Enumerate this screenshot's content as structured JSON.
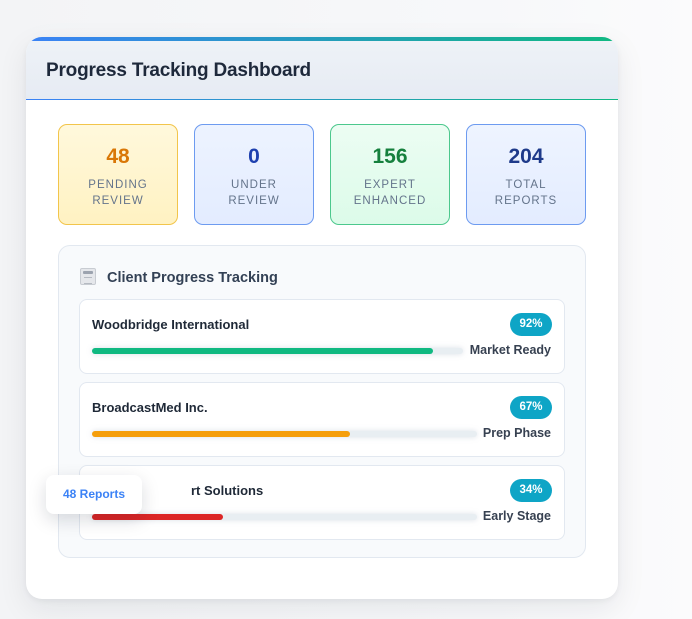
{
  "header": {
    "title": "Progress Tracking Dashboard"
  },
  "stats": [
    {
      "value": "48",
      "label": "PENDING REVIEW",
      "color": "#d97706"
    },
    {
      "value": "0",
      "label": "UNDER REVIEW",
      "color": "#1e40af"
    },
    {
      "value": "156",
      "label": "EXPERT ENHANCED",
      "color": "#15803d"
    },
    {
      "value": "204",
      "label": "TOTAL REPORTS",
      "color": "#1e3a8a"
    }
  ],
  "tracking": {
    "title": "Client Progress Tracking",
    "icon": "clipboard-icon",
    "clients": [
      {
        "name": "Woodbridge International",
        "percent_label": "92%",
        "progress": 0.92,
        "stage": "Market Ready",
        "bar_color": "#10b981"
      },
      {
        "name": "BroadcastMed Inc.",
        "percent_label": "67%",
        "progress": 0.67,
        "stage": "Prep Phase",
        "bar_color": "#f59e0b"
      },
      {
        "name": "rt Solutions",
        "percent_label": "34%",
        "progress": 0.34,
        "stage": "Early Stage",
        "bar_color": "#dc2626"
      }
    ]
  },
  "floating_tag": {
    "label": "48 Reports"
  }
}
